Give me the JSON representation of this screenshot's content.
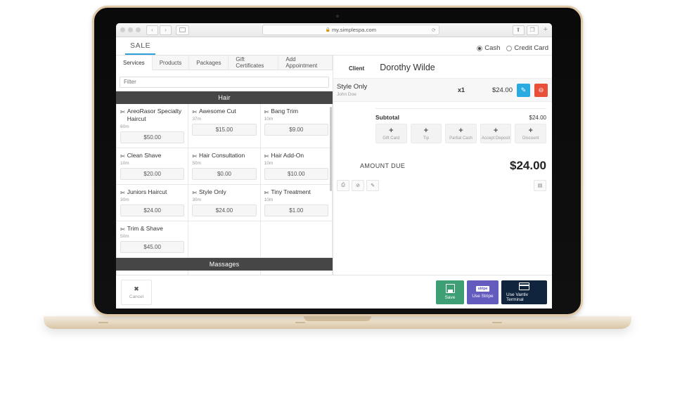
{
  "device": {
    "name": "MacBook"
  },
  "browser": {
    "url": "my.simplespa.com",
    "lock_icon": "lock-icon",
    "reload_icon": "reload-icon",
    "back_icon": "‹",
    "forward_icon": "›",
    "sidebar_icon": "sidebar-icon",
    "share_icon": "share-icon",
    "tabs_icon": "tabs-icon",
    "newtab_icon": "+"
  },
  "app": {
    "sale_tab": "SALE",
    "payment_types": [
      {
        "label": "Cash",
        "selected": true
      },
      {
        "label": "Credit Card",
        "selected": false
      }
    ],
    "subtabs": [
      {
        "label": "Services",
        "active": true
      },
      {
        "label": "Products",
        "active": false
      },
      {
        "label": "Packages",
        "active": false
      },
      {
        "label": "Gift Certificates",
        "active": false
      },
      {
        "label": "Add Appointment",
        "active": false
      }
    ],
    "filter_placeholder": "Filter",
    "sections": [
      {
        "title": "Hair",
        "services": [
          {
            "name": "AreoRasor Specialty Haircut",
            "duration": "60m",
            "price": "$50.00"
          },
          {
            "name": "Awesome Cut",
            "duration": "37m",
            "price": "$15.00"
          },
          {
            "name": "Bang Trim",
            "duration": "10m",
            "price": "$9.00"
          },
          {
            "name": "Clean Shave",
            "duration": "10m",
            "price": "$20.00"
          },
          {
            "name": "Hair Consultation",
            "duration": "50m",
            "price": "$0.00"
          },
          {
            "name": "Hair Add-On",
            "duration": "10m",
            "price": "$10.00"
          },
          {
            "name": "Juniors Haircut",
            "duration": "30m",
            "price": "$24.00"
          },
          {
            "name": "Style Only",
            "duration": "30m",
            "price": "$24.00"
          },
          {
            "name": "Tiny Treatment",
            "duration": "10m",
            "price": "$1.00"
          },
          {
            "name": "Trim & Shave",
            "duration": "50m",
            "price": "$45.00"
          }
        ]
      },
      {
        "title": "Massages",
        "services": []
      }
    ],
    "order": {
      "client_label": "Client",
      "client_name": "Dorothy Wilde",
      "line_items": [
        {
          "name": "Style Only",
          "staff": "John Doe",
          "qty": "x1",
          "price": "$24.00",
          "edit_icon": "pencil-icon",
          "remove_icon": "minus-circle-icon"
        }
      ],
      "subtotal_label": "Subtotal",
      "subtotal_value": "$24.00",
      "add_buttons": [
        {
          "plus": "+",
          "label": "Gift Card"
        },
        {
          "plus": "+",
          "label": "Tip"
        },
        {
          "plus": "+",
          "label": "Partial Cash"
        },
        {
          "plus": "+",
          "label": "Accept Deposit"
        },
        {
          "plus": "+",
          "label": "Discount"
        }
      ],
      "amount_due_label": "AMOUNT DUE",
      "amount_due_value": "$24.00",
      "tools": [
        {
          "icon": "print-icon",
          "glyph": "⎙"
        },
        {
          "icon": "no-entry-icon",
          "glyph": "⊘"
        },
        {
          "icon": "edit-square-icon",
          "glyph": "✎"
        }
      ],
      "far_tool": {
        "icon": "calculator-icon",
        "glyph": "▤"
      }
    },
    "footer": {
      "cancel": {
        "icon": "close-icon",
        "glyph": "✖",
        "label": "Cancel"
      },
      "save": {
        "icon": "save-icon",
        "label": "Save",
        "color": "#3e9e74"
      },
      "stripe": {
        "icon": "stripe-logo",
        "logo_text": "stripe",
        "label": "Use Stripe",
        "color": "#635bbe"
      },
      "vantiv": {
        "icon": "credit-card-icon",
        "label": "Use Vantiv Terminal",
        "color": "#10243e"
      }
    }
  },
  "colors": {
    "accent_blue": "#2e9fd8",
    "edit_blue": "#29abe2",
    "delete_red": "#e8503a",
    "section_header": "#464646"
  }
}
